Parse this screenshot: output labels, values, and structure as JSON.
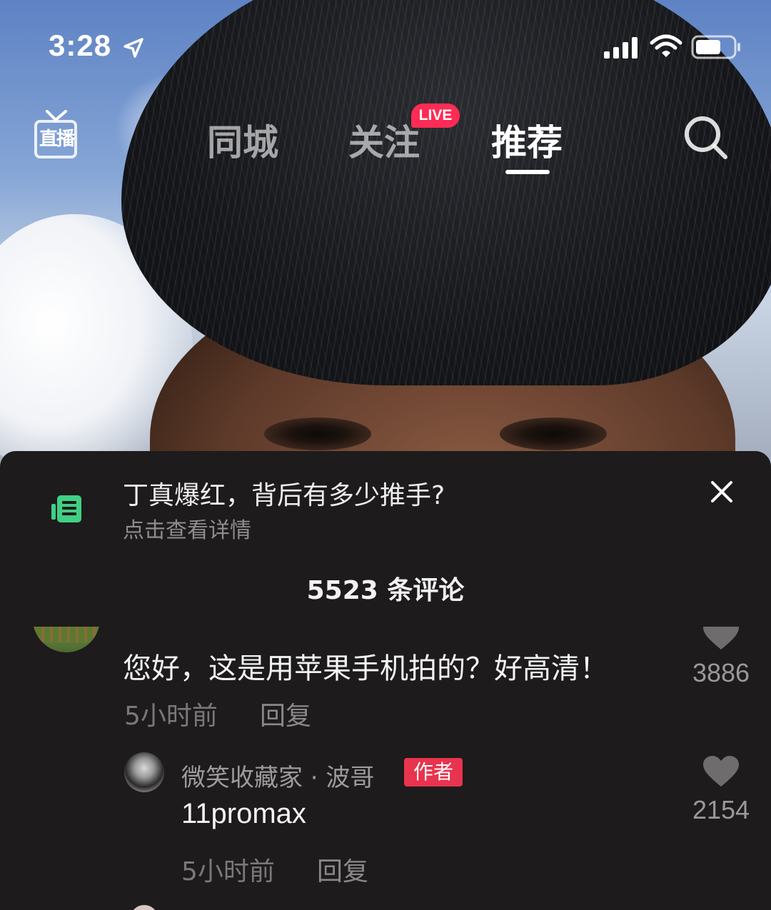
{
  "status_bar": {
    "time": "3:28",
    "icons": [
      "location-arrow-icon",
      "signal-icon",
      "wifi-icon",
      "battery-icon"
    ]
  },
  "top_nav": {
    "live_entry_label": "直播",
    "tabs": [
      {
        "label": "同城",
        "active": false
      },
      {
        "label": "关注",
        "active": false,
        "badge": "LIVE"
      },
      {
        "label": "推荐",
        "active": true
      }
    ],
    "search_icon": "search-icon"
  },
  "comment_panel": {
    "notice": {
      "icon": "document-icon",
      "title": "丁真爆红，背后有多少推手?",
      "subtitle": "点击查看详情"
    },
    "count_label": "5523 条评论",
    "comments": [
      {
        "text": "您好，这是用苹果手机拍的？好高清！",
        "time": "5小时前",
        "reply_label": "回复",
        "likes": "3886"
      }
    ],
    "replies": [
      {
        "author": "微笑收藏家 · 波哥",
        "badge": "作者",
        "text": "11promax",
        "time": "5小时前",
        "reply_label": "回复",
        "likes": "2154"
      }
    ]
  },
  "colors": {
    "panel_bg": "#1d1b1b",
    "live_badge": "#fe2c55",
    "author_badge": "#e8344e",
    "notice_icon": "#3fd084"
  }
}
